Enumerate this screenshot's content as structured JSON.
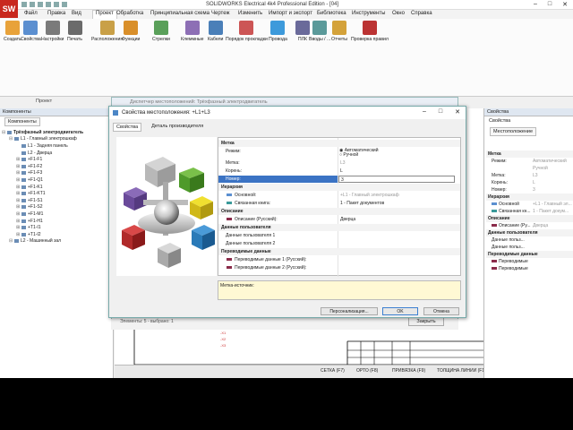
{
  "app": {
    "logo_text": "SW",
    "title": "SOLIDWORKS Electrical 4k4 Professional Edition - [04]",
    "window_buttons": [
      "–",
      "□",
      "✕"
    ]
  },
  "menu": [
    "Файл",
    "Правка",
    "Вид",
    "Проект",
    "Обработка",
    "Принципиальная схема",
    "Чертеж",
    "Изменить",
    "Импорт и экспорт",
    "Библиотека",
    "Инструменты",
    "Окно",
    "Справка"
  ],
  "ribbon": {
    "buttons": [
      {
        "label": "Создать",
        "color": "#e8a23a"
      },
      {
        "label": "Свойства",
        "color": "#5b8fd0"
      },
      {
        "label": "Настройки",
        "color": "#7a7a7a"
      },
      {
        "label": "Печать",
        "color": "#6b6b6b"
      },
      {
        "label": "Расположения",
        "color": "#c9a047"
      },
      {
        "label": "Функции",
        "color": "#d98f2a"
      },
      {
        "label": "Стрелки",
        "color": "#5aa05a"
      },
      {
        "label": "Клеммные",
        "color": "#8d6fb5"
      },
      {
        "label": "Кабели",
        "color": "#4a7fb8"
      },
      {
        "label": "Порядок прокладки",
        "color": "#c55"
      },
      {
        "label": "Провода",
        "color": "#3d9adb"
      },
      {
        "label": "ПЛК",
        "color": "#6a6a9a"
      },
      {
        "label": "Вводы / ...",
        "color": "#5b9a9a"
      },
      {
        "label": "Отчеты",
        "color": "#d4a23a"
      },
      {
        "label": "Проверка правил",
        "color": "#b33"
      }
    ],
    "group_label": "Проект"
  },
  "left_panel": {
    "title": "Компоненты",
    "tab": "Компоненты",
    "tree": [
      {
        "label": "Трёхфазный электродвигатель",
        "level": 0,
        "bold": true
      },
      {
        "label": "L1 - Главный электрошкаф",
        "level": 1
      },
      {
        "label": "L1 - Задняя панель",
        "level": 2
      },
      {
        "label": "L2 - Дверца",
        "level": 2
      },
      {
        "label": "+F1-F1",
        "level": 2
      },
      {
        "label": "+F1-F2",
        "level": 2
      },
      {
        "label": "+F1-F3",
        "level": 2
      },
      {
        "label": "+F1-Q1",
        "level": 2
      },
      {
        "label": "+F1-K1",
        "level": 2
      },
      {
        "label": "+F1-KT1",
        "level": 2
      },
      {
        "label": "+F1-S1",
        "level": 2
      },
      {
        "label": "+F1-S2",
        "level": 2
      },
      {
        "label": "+F1-M1",
        "level": 2
      },
      {
        "label": "+F1-H1",
        "level": 2
      },
      {
        "label": "+T1-I1",
        "level": 2
      },
      {
        "label": "+T1-I2",
        "level": 2
      },
      {
        "label": "L2 - Машинный зал",
        "level": 1
      }
    ]
  },
  "bg_dialog": {
    "title": "Диспетчер местоположений: Трёхфазный электродвигатель",
    "selection": "Элементы: 5 - выбрано: 1",
    "close_label": "Закрыть"
  },
  "dialog": {
    "title": "Свойства местоположения: +L1+L3",
    "window_buttons": [
      "–",
      "□",
      "✕"
    ],
    "tabs": [
      "Свойства",
      "Деталь производителя"
    ],
    "grid": [
      {
        "type": "section",
        "label": "Метка"
      },
      {
        "type": "radio",
        "label": "Режим:",
        "options": [
          "Автоматический",
          "Ручной"
        ]
      },
      {
        "type": "field",
        "label": "Метка:",
        "value": "L3",
        "muted": true
      },
      {
        "type": "field",
        "label": "Корень:",
        "value": "L"
      },
      {
        "type": "field",
        "label": "Номер:",
        "value": "3",
        "selected": true
      },
      {
        "type": "section",
        "label": "Иерархия"
      },
      {
        "type": "field",
        "label": "Основной:",
        "value": "+L1 - Главный электрошкаф",
        "muted": true,
        "swatch": "#5b8fd0"
      },
      {
        "type": "field",
        "label": "Связанная книга:",
        "value": "1 - Пакет документов",
        "swatch": "#3a9a9a"
      },
      {
        "type": "section",
        "label": "Описание"
      },
      {
        "type": "field",
        "label": "Описание (Русский):",
        "value": "Дверца",
        "swatch": "#8a2b4a"
      },
      {
        "type": "section",
        "label": "Данные пользователя"
      },
      {
        "type": "field",
        "label": "Данные пользователя 1",
        "value": ""
      },
      {
        "type": "field",
        "label": "Данные пользователя 2",
        "value": ""
      },
      {
        "type": "section",
        "label": "Переводимые данные"
      },
      {
        "type": "field",
        "label": "Переводимые данные 1 (Русский):",
        "value": "",
        "swatch": "#8a2b4a"
      },
      {
        "type": "field",
        "label": "Переводимые данные 2 (Русский):",
        "value": "",
        "swatch": "#8a2b4a"
      }
    ],
    "note_label": "Метка-источник:",
    "buttons": {
      "customize": "Персонализация...",
      "ok": "OK",
      "cancel": "Отмена"
    }
  },
  "right_panel": {
    "title": "Свойства",
    "tab": "Свойства",
    "sub_tab": "Местоположение",
    "rows": [
      {
        "type": "section",
        "label": "Метка"
      },
      {
        "type": "field",
        "label": "Режим:",
        "value": "Автоматический"
      },
      {
        "type": "field",
        "label": "",
        "value": "Ручной"
      },
      {
        "type": "field",
        "label": "Метка:",
        "value": "L3"
      },
      {
        "type": "field",
        "label": "Корень:",
        "value": "L"
      },
      {
        "type": "field",
        "label": "Номер:",
        "value": "3"
      },
      {
        "type": "section",
        "label": "Иерархия"
      },
      {
        "type": "field",
        "label": "Основной",
        "value": "+L1 - Главный эл...",
        "swatch": "#5b8fd0"
      },
      {
        "type": "field",
        "label": "Связанная кн...",
        "value": "1 - Пакет докум...",
        "swatch": "#3a9a9a"
      },
      {
        "type": "section",
        "label": "Описание"
      },
      {
        "type": "field",
        "label": "Описание (Ру...",
        "value": "Дверца",
        "swatch": "#8a2b4a"
      },
      {
        "type": "section",
        "label": "Данные пользователя"
      },
      {
        "type": "field",
        "label": "Данные польз...",
        "value": ""
      },
      {
        "type": "field",
        "label": "Данные польз...",
        "value": ""
      },
      {
        "type": "section",
        "label": "Переводимые данные"
      },
      {
        "type": "field",
        "label": "Переводимые",
        "value": "",
        "swatch": "#8a2b4a"
      },
      {
        "type": "field",
        "label": "Переводимые",
        "value": "",
        "swatch": "#8a2b4a"
      }
    ]
  },
  "status_bar": [
    "СЕТКА (F7)",
    "ОРТО (F8)",
    "ПРИВЯЗКА (F9)",
    "ТОЛЩИНА ЛИНИИ (F10)",
    "ПРИВЯЗ ОБЪЕКТОВ (F11)"
  ],
  "canvas_labels": [
    "-X1",
    "-X2",
    "-X3"
  ],
  "colors": {
    "accent": "#3b73c4",
    "logo": "#c8281e",
    "note": "#fff9d4"
  }
}
